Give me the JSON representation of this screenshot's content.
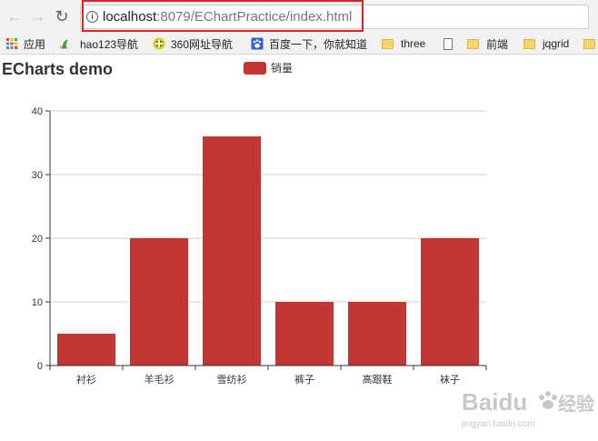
{
  "browser": {
    "url_host": "localhost",
    "url_rest": ":8079/EChartPractice/index.html",
    "info_symbol": "i",
    "highlight_color": "#e02020"
  },
  "bookmarks": [
    {
      "label": "应用",
      "icon": "apps-grid-icon"
    },
    {
      "label": "hao123导航",
      "icon": "hao123-icon"
    },
    {
      "label": "360网址导航",
      "icon": "360-icon"
    },
    {
      "label": "百度一下，你就知道",
      "icon": "baidu-paw-icon"
    },
    {
      "label": "three",
      "icon": "folder-icon"
    },
    {
      "label": "",
      "icon": "page-icon"
    },
    {
      "label": "前端",
      "icon": "folder-icon"
    },
    {
      "label": "jqgrid",
      "icon": "folder-icon"
    }
  ],
  "chart": {
    "title": "ECharts demo",
    "bar_color": "#c23531"
  },
  "chart_data": {
    "type": "bar",
    "title": "ECharts demo",
    "categories": [
      "衬衫",
      "羊毛衫",
      "雪纺衫",
      "裤子",
      "高跟鞋",
      "袜子"
    ],
    "series": [
      {
        "name": "销量",
        "values": [
          5,
          20,
          36,
          10,
          10,
          20
        ]
      }
    ],
    "ylim": [
      0,
      40
    ],
    "yticks": [
      0,
      10,
      20,
      30,
      40
    ],
    "grid": "horizontal",
    "legend_position": "top-center"
  },
  "watermark": {
    "brand": "Baidu",
    "cn": "经验",
    "domain": "jingyan.baidu.com"
  }
}
